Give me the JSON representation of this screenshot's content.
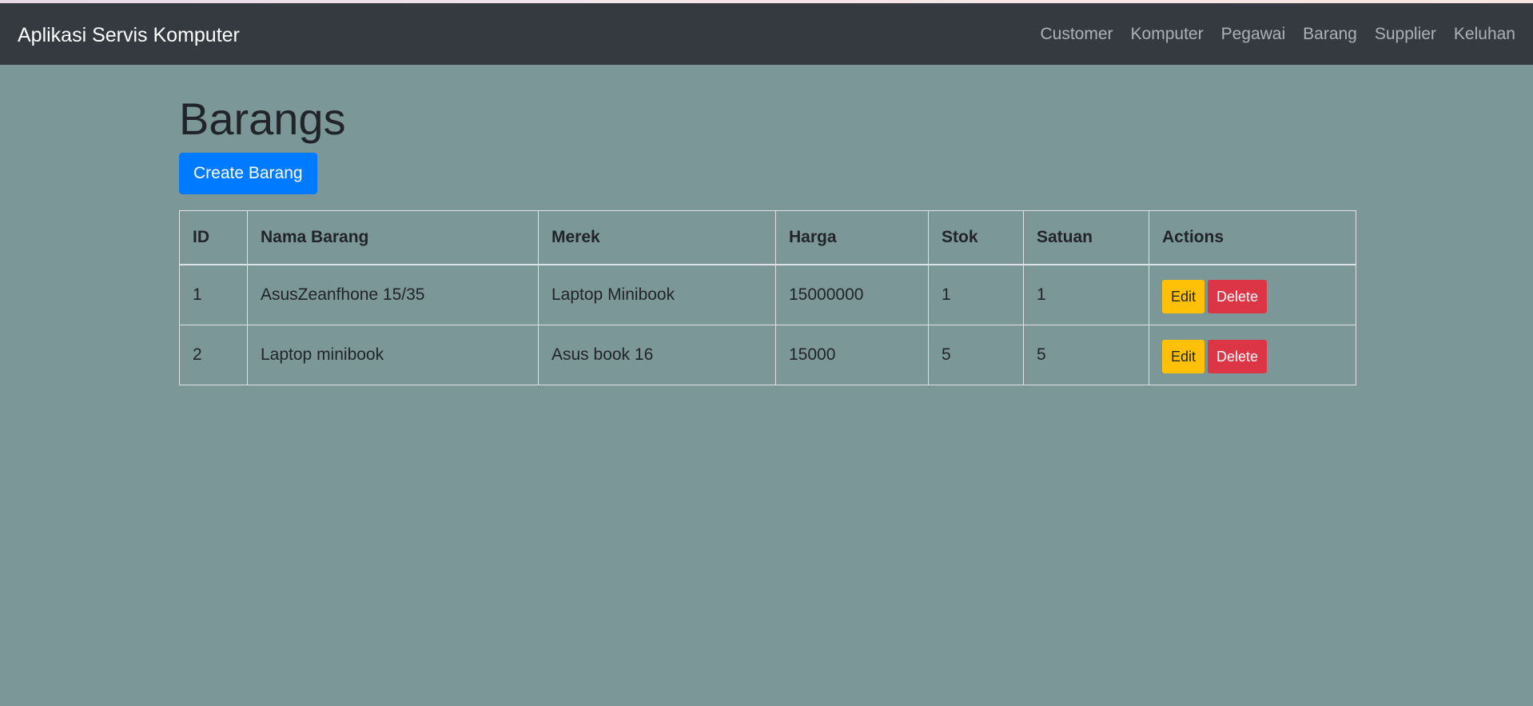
{
  "navbar": {
    "brand": "Aplikasi Servis Komputer",
    "links": [
      "Customer",
      "Komputer",
      "Pegawai",
      "Barang",
      "Supplier",
      "Keluhan"
    ]
  },
  "page": {
    "title": "Barangs",
    "create_button": "Create Barang"
  },
  "table": {
    "headers": [
      "ID",
      "Nama Barang",
      "Merek",
      "Harga",
      "Stok",
      "Satuan",
      "Actions"
    ],
    "rows": [
      {
        "id": "1",
        "nama_barang": "AsusZeanfhone 15/35",
        "merek": "Laptop Minibook",
        "harga": "15000000",
        "stok": "1",
        "satuan": "1",
        "edit_label": "Edit",
        "delete_label": "Delete"
      },
      {
        "id": "2",
        "nama_barang": "Laptop minibook",
        "merek": "Asus book 16",
        "harga": "15000",
        "stok": "5",
        "satuan": "5",
        "edit_label": "Edit",
        "delete_label": "Delete"
      }
    ]
  },
  "colors": {
    "navbar_bg": "#343a40",
    "page_bg": "#7c9797",
    "primary": "#007bff",
    "warning": "#ffc107",
    "danger": "#dc3545"
  }
}
